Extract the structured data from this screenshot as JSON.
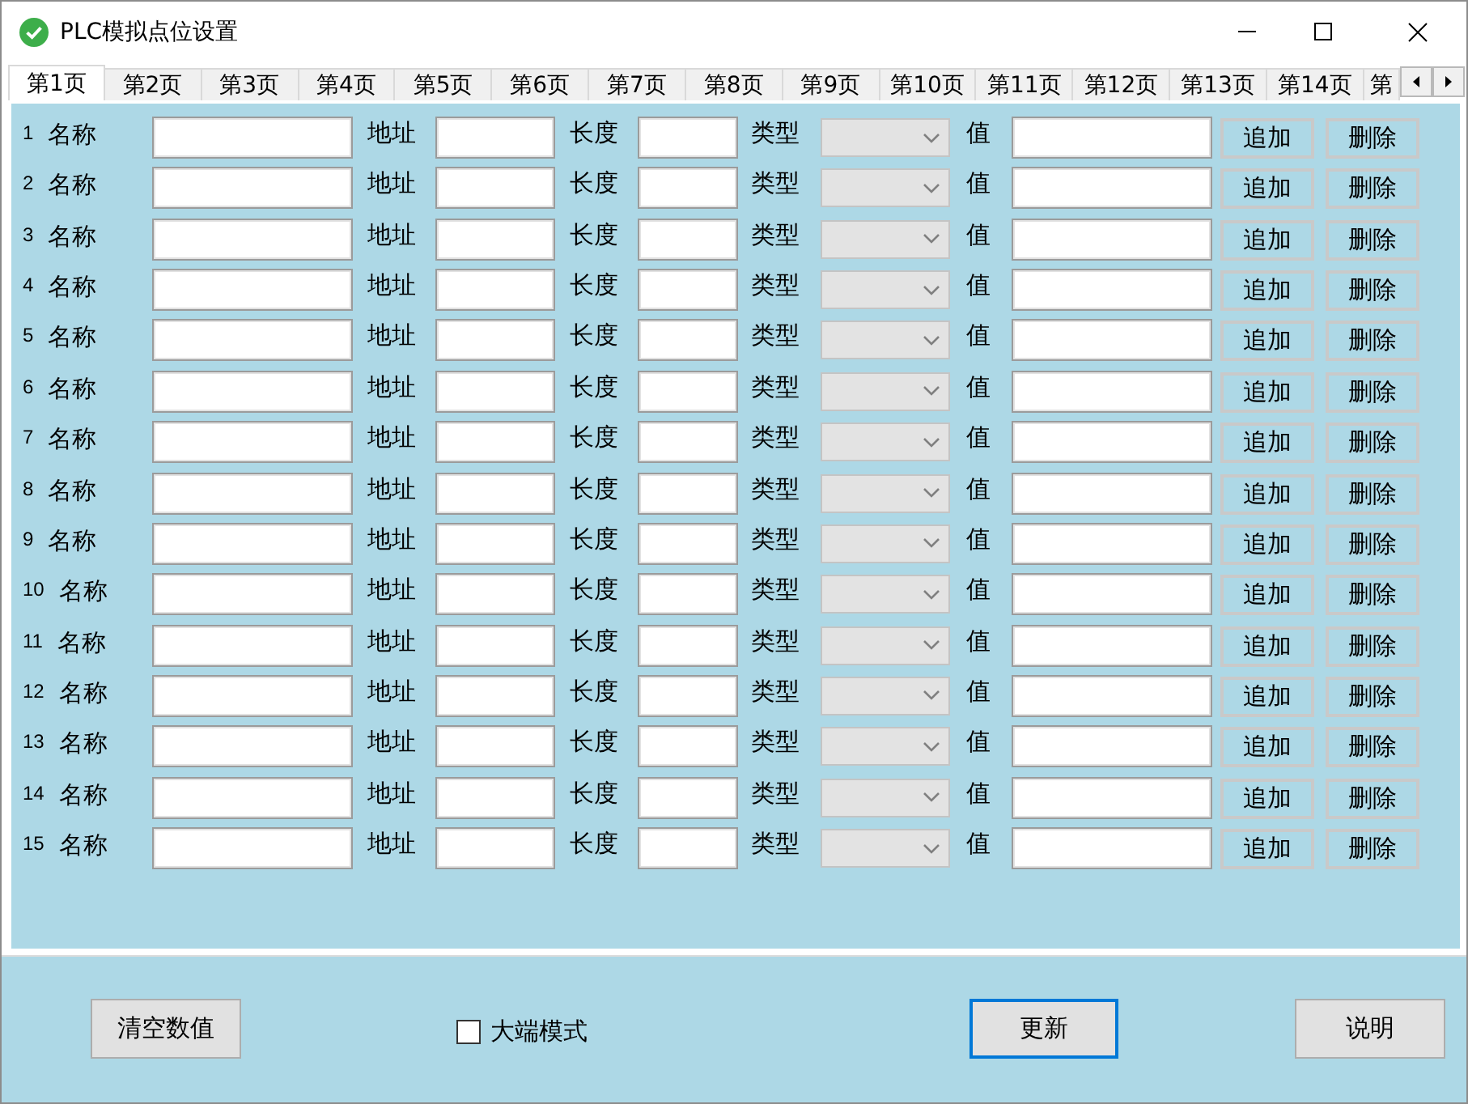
{
  "window": {
    "title": "PLC模拟点位设置"
  },
  "tabs": [
    {
      "label": "第1页",
      "selected": true
    },
    {
      "label": "第2页",
      "selected": false
    },
    {
      "label": "第3页",
      "selected": false
    },
    {
      "label": "第4页",
      "selected": false
    },
    {
      "label": "第5页",
      "selected": false
    },
    {
      "label": "第6页",
      "selected": false
    },
    {
      "label": "第7页",
      "selected": false
    },
    {
      "label": "第8页",
      "selected": false
    },
    {
      "label": "第9页",
      "selected": false
    },
    {
      "label": "第10页",
      "selected": false
    },
    {
      "label": "第11页",
      "selected": false
    },
    {
      "label": "第12页",
      "selected": false
    },
    {
      "label": "第13页",
      "selected": false
    },
    {
      "label": "第14页",
      "selected": false
    },
    {
      "label": "第",
      "selected": false
    }
  ],
  "rows": [
    {
      "index": "1",
      "name_label": "名称",
      "address_label": "地址",
      "length_label": "长度",
      "type_label": "类型",
      "type_disabled": true,
      "value_label": "值",
      "add_button": "追加",
      "delete_button": "删除"
    },
    {
      "index": "2",
      "name_label": "名称",
      "address_label": "地址",
      "length_label": "长度",
      "type_label": "类型",
      "type_disabled": true,
      "value_label": "值",
      "add_button": "追加",
      "delete_button": "删除"
    },
    {
      "index": "3",
      "name_label": "名称",
      "address_label": "地址",
      "length_label": "长度",
      "type_label": "类型",
      "type_disabled": true,
      "value_label": "值",
      "add_button": "追加",
      "delete_button": "删除"
    },
    {
      "index": "4",
      "name_label": "名称",
      "address_label": "地址",
      "length_label": "长度",
      "type_label": "类型",
      "type_disabled": true,
      "value_label": "值",
      "add_button": "追加",
      "delete_button": "删除"
    },
    {
      "index": "5",
      "name_label": "名称",
      "address_label": "地址",
      "length_label": "长度",
      "type_label": "类型",
      "type_disabled": true,
      "value_label": "值",
      "add_button": "追加",
      "delete_button": "删除"
    },
    {
      "index": "6",
      "name_label": "名称",
      "address_label": "地址",
      "length_label": "长度",
      "type_label": "类型",
      "type_disabled": true,
      "value_label": "值",
      "add_button": "追加",
      "delete_button": "删除"
    },
    {
      "index": "7",
      "name_label": "名称",
      "address_label": "地址",
      "length_label": "长度",
      "type_label": "类型",
      "type_disabled": true,
      "value_label": "值",
      "add_button": "追加",
      "delete_button": "删除"
    },
    {
      "index": "8",
      "name_label": "名称",
      "address_label": "地址",
      "length_label": "长度",
      "type_label": "类型",
      "type_disabled": true,
      "value_label": "值",
      "add_button": "追加",
      "delete_button": "删除"
    },
    {
      "index": "9",
      "name_label": "名称",
      "address_label": "地址",
      "length_label": "长度",
      "type_label": "类型",
      "type_disabled": true,
      "value_label": "值",
      "add_button": "追加",
      "delete_button": "删除"
    },
    {
      "index": "10",
      "name_label": "名称",
      "address_label": "地址",
      "length_label": "长度",
      "type_label": "类型",
      "type_disabled": true,
      "value_label": "值",
      "add_button": "追加",
      "delete_button": "删除"
    },
    {
      "index": "11",
      "name_label": "名称",
      "address_label": "地址",
      "length_label": "长度",
      "type_label": "类型",
      "type_disabled": true,
      "value_label": "值",
      "add_button": "追加",
      "delete_button": "删除"
    },
    {
      "index": "12",
      "name_label": "名称",
      "address_label": "地址",
      "length_label": "长度",
      "type_label": "类型",
      "type_disabled": true,
      "value_label": "值",
      "add_button": "追加",
      "delete_button": "删除"
    },
    {
      "index": "13",
      "name_label": "名称",
      "address_label": "地址",
      "length_label": "长度",
      "type_label": "类型",
      "type_disabled": true,
      "value_label": "值",
      "add_button": "追加",
      "delete_button": "删除"
    },
    {
      "index": "14",
      "name_label": "名称",
      "address_label": "地址",
      "length_label": "长度",
      "type_label": "类型",
      "type_disabled": true,
      "value_label": "值",
      "add_button": "追加",
      "delete_button": "删除"
    },
    {
      "index": "15",
      "name_label": "名称",
      "address_label": "地址",
      "length_label": "长度",
      "type_label": "类型",
      "type_disabled": true,
      "value_label": "值",
      "add_button": "追加",
      "delete_button": "删除"
    }
  ],
  "footer": {
    "clear_button": "清空数值",
    "big_endian": {
      "label": "大端模式",
      "checked": false
    },
    "update_button": {
      "label": "更新",
      "focused": true
    },
    "help_button": "说明"
  }
}
